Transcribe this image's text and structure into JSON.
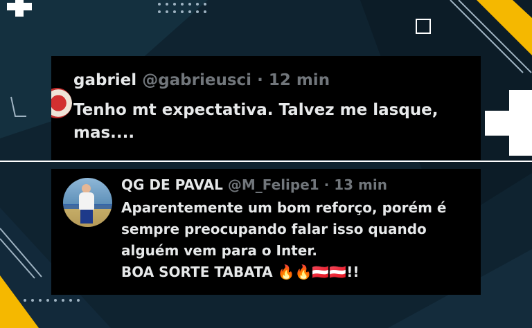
{
  "tweets": [
    {
      "display_name": "gabriel",
      "handle": "@gabrieusci",
      "separator": "·",
      "time": "12 min",
      "text": "Tenho mt expectativa. Talvez me lasque, mas...."
    },
    {
      "display_name": "QG DE PAVAL",
      "handle": "@M_Felipe1",
      "separator": "·",
      "time": "13 min",
      "text": "Aparentemente um bom reforço, porém é sempre preocupando falar isso quando alguém vem para o Inter.\nBOA SORTE TABATA 🔥🔥🇦🇹🇦🇹!!"
    }
  ],
  "colors": {
    "background": "#0f2330",
    "accent": "#f5b800",
    "card": "#000000",
    "text": "#e7e9ea",
    "muted": "#71767b"
  }
}
